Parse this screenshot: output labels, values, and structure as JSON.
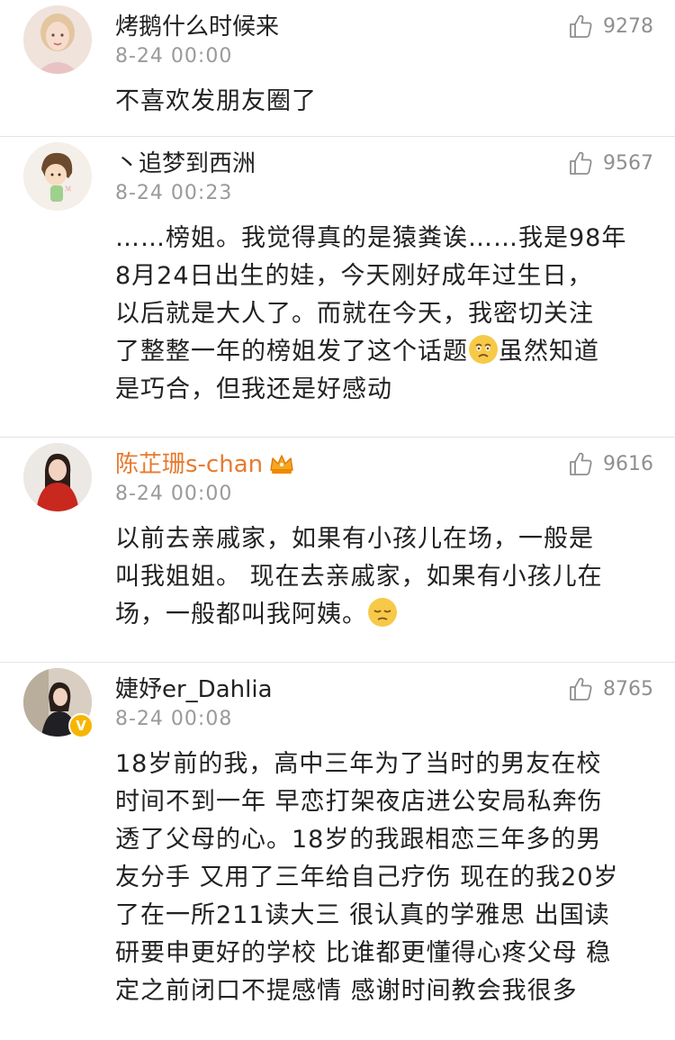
{
  "comments": [
    {
      "username": "烤鹅什么时候来",
      "time": "8-24 00:00",
      "likes": "9278",
      "text": "不喜欢发朋友圈了",
      "avatar_icon": "avatar-photo-woman-blonde"
    },
    {
      "username": "丶追梦到西洲",
      "time": "8-24 00:23",
      "likes": "9567",
      "text_before": "……榜姐。我觉得真的是猿粪诶……我是98年\n8月24日出生的娃，今天刚好成年过生日，\n以后就是大人了。而就在今天，我密切关注\n了整整一年的榜姐发了这个话题",
      "emoji": "moved-tears-emoji",
      "text_after": "虽然知道\n是巧合，但我还是好感动",
      "avatar_icon": "avatar-cartoon-girl"
    },
    {
      "username": "陈芷珊s-chan",
      "time": "8-24 00:00",
      "likes": "9616",
      "text_before": "以前去亲戚家，如果有小孩儿在场，一般是\n叫我姐姐。 现在去亲戚家，如果有小孩儿在\n场，一般都叫我阿姨。",
      "emoji": "pensive-emoji",
      "text_after": "",
      "vip_badge": "vip-crown-icon",
      "name_color": "#e87a2d",
      "avatar_icon": "avatar-photo-woman-red-coat"
    },
    {
      "username": "婕妤er_Dahlia",
      "time": "8-24 00:08",
      "likes": "8765",
      "text": "18岁前的我，高中三年为了当时的男友在校\n时间不到一年 早恋打架夜店进公安局私奔伤\n透了父母的心。18岁的我跟相恋三年多的男\n友分手 又用了三年给自己疗伤 现在的我20岁\n了在一所211读大三 很认真的学雅思 出国读\n研要申更好的学校 比谁都更懂得心疼父母 稳\n定之前闭口不提感情 感谢时间教会我很多",
      "verified_badge": "V",
      "avatar_icon": "avatar-photo-woman-dark"
    }
  ],
  "colors": {
    "text": "#222222",
    "meta": "#9a9a9a",
    "vip_name": "#e87a2d",
    "divider": "#e4e4e4",
    "verified": "#f7b500"
  }
}
